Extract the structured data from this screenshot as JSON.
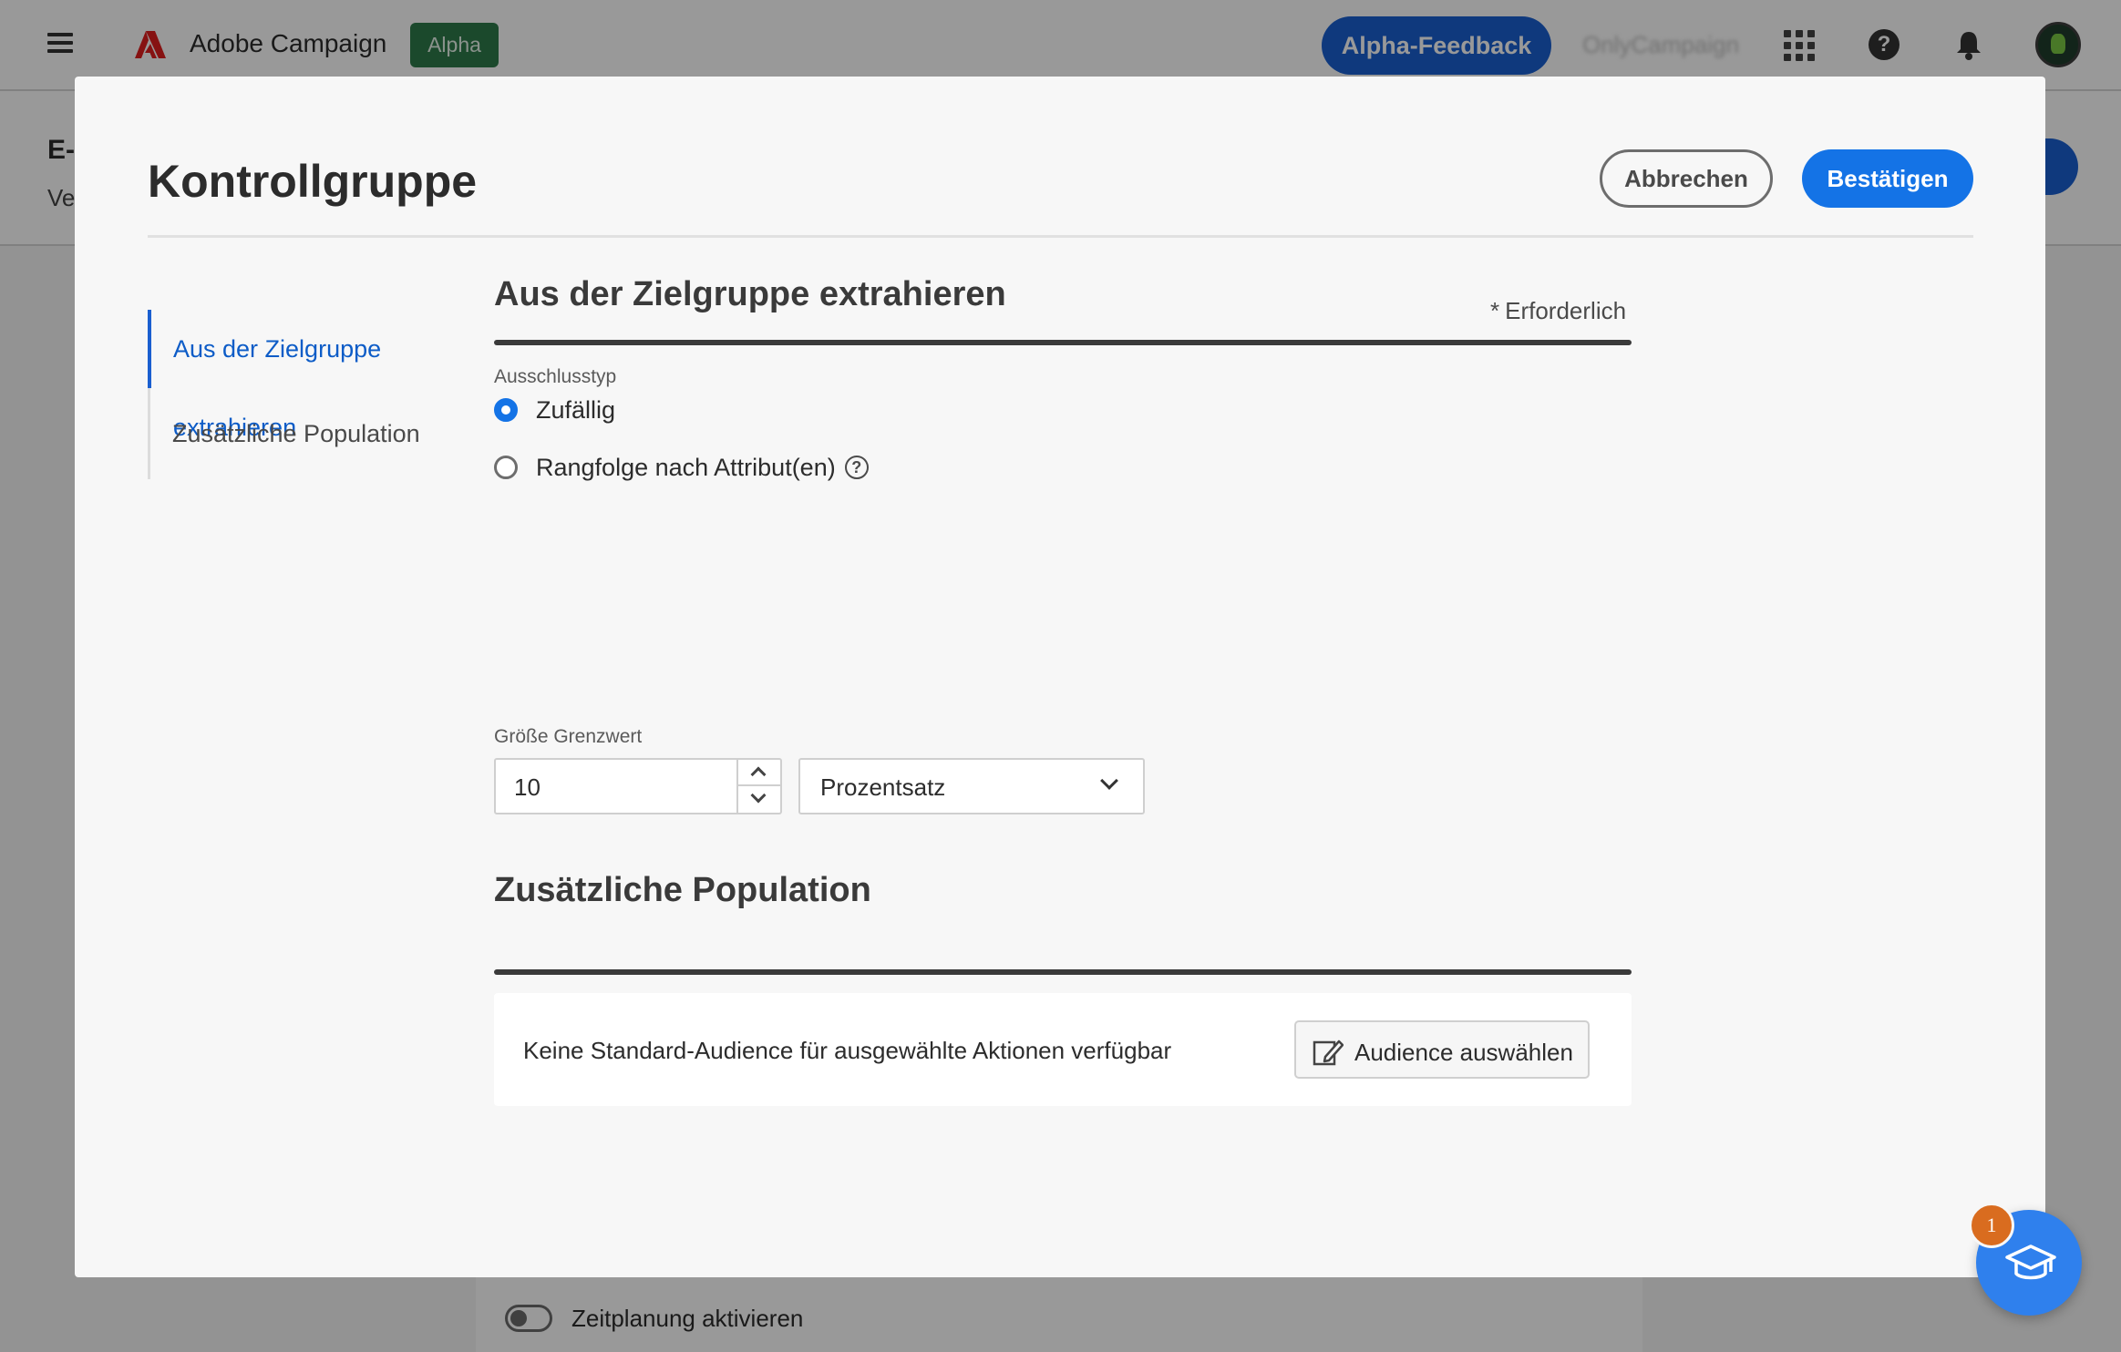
{
  "topbar": {
    "app_name": "Adobe Campaign",
    "alpha_badge": "Alpha",
    "feedback_button": "Alpha-Feedback",
    "org_name": "OnlyCampaign",
    "help_glyph": "?"
  },
  "background": {
    "title_fragment": "E-",
    "subtitle_fragment": "Ve",
    "toggle_label": "Zeitplanung aktivieren"
  },
  "modal": {
    "title": "Kontrollgruppe",
    "cancel_label": "Abbrechen",
    "confirm_label": "Bestätigen",
    "required_star": "*",
    "required_label": "Erforderlich",
    "nav": [
      {
        "label": "Aus der Zielgruppe extrahieren",
        "active": true
      },
      {
        "label": "Zusätzliche Population",
        "active": false
      }
    ],
    "extract_section": {
      "title": "Aus der Zielgruppe extrahieren",
      "exclusion_type_label": "Ausschlusstyp",
      "options": [
        {
          "label": "Zufällig",
          "selected": true
        },
        {
          "label": "Rangfolge nach Attribut(en)",
          "selected": false
        }
      ],
      "info_glyph": "?",
      "size_limit_label": "Größe Grenzwert",
      "size_limit_value": "10",
      "unit_value": "Prozentsatz"
    },
    "population_section": {
      "title": "Zusätzliche Population",
      "empty_message": "Keine Standard-Audience für ausgewählte Aktionen verfügbar",
      "select_audience_label": "Audience auswählen"
    }
  },
  "help_fab": {
    "badge_count": "1"
  },
  "colors": {
    "accent": "#1473e6",
    "feedback_blue": "#1a5fd0",
    "alpha_green": "#2d7a4a",
    "badge_orange": "#d96c1f"
  },
  "icons": [
    "menu-icon",
    "adobe-logo-icon",
    "apps-grid-icon",
    "help-icon",
    "bell-icon",
    "avatar",
    "info-icon",
    "edit-icon",
    "graduation-cap-icon"
  ]
}
